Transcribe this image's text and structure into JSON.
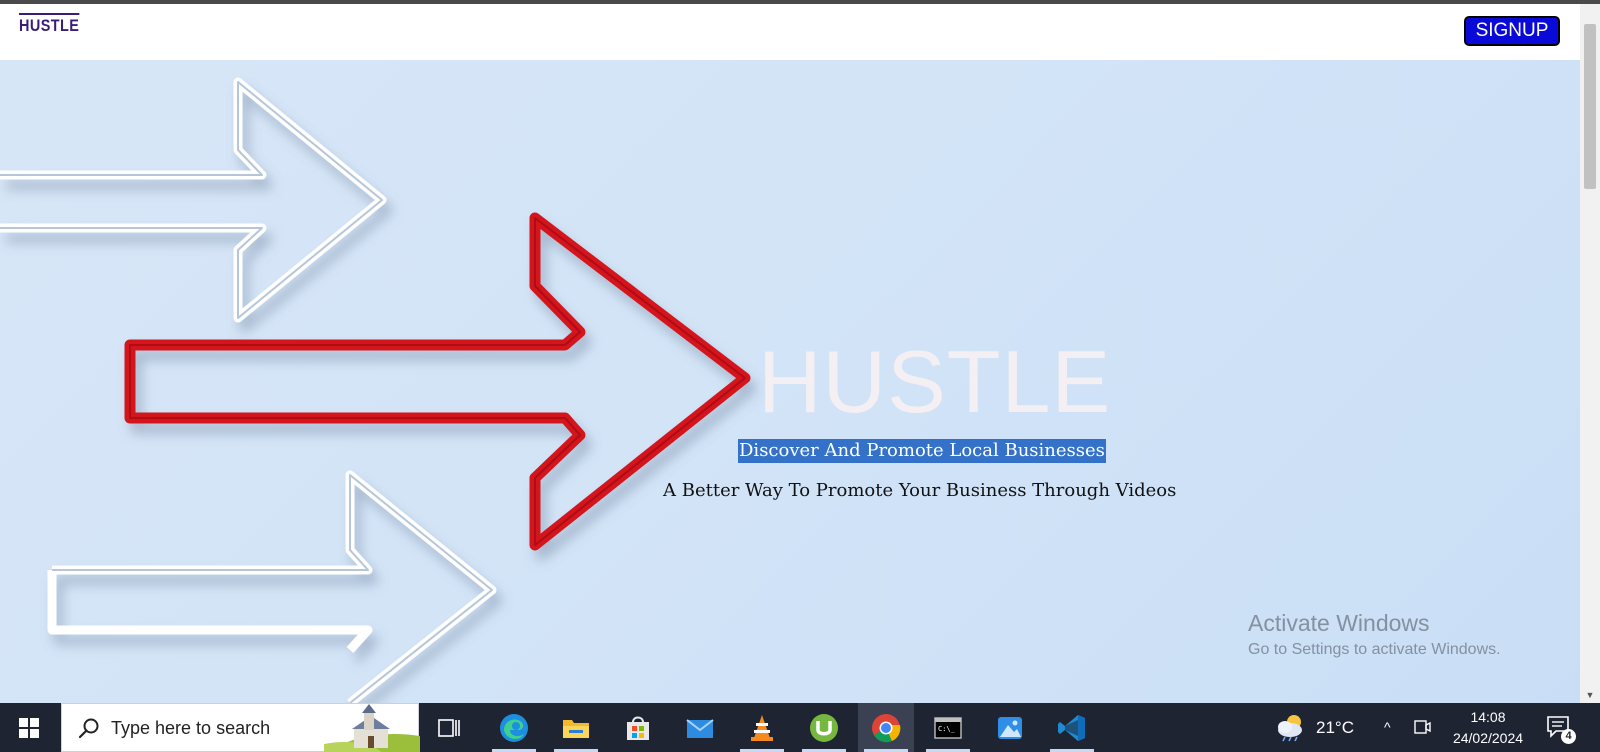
{
  "navbar": {
    "brand": "HUSTLE",
    "signup_label": "SIGNUP",
    "signup_color": "#0a0ad8"
  },
  "hero": {
    "title": "HUSTLE",
    "tagline": "Discover And Promote Local Businesses",
    "subtitle": "A Better Way To Promote Your Business Through Videos",
    "background_color": "#d3e4f7",
    "red_arrow_color": "#d4121c",
    "white_arrow_color": "#ffffff"
  },
  "watermark": {
    "title": "Activate Windows",
    "subtitle": "Go to Settings to activate Windows."
  },
  "taskbar": {
    "search_placeholder": "Type here to search",
    "apps": [
      {
        "name": "task-view-icon"
      },
      {
        "name": "edge-icon"
      },
      {
        "name": "file-explorer-icon"
      },
      {
        "name": "microsoft-store-icon"
      },
      {
        "name": "mail-icon"
      },
      {
        "name": "vlc-icon"
      },
      {
        "name": "utorrent-icon"
      },
      {
        "name": "chrome-icon",
        "active": true
      },
      {
        "name": "terminal-icon"
      },
      {
        "name": "photos-icon"
      },
      {
        "name": "vscode-icon"
      }
    ],
    "weather_temp": "21°C",
    "time": "14:08",
    "date": "24/02/2024",
    "notification_count": "4"
  }
}
